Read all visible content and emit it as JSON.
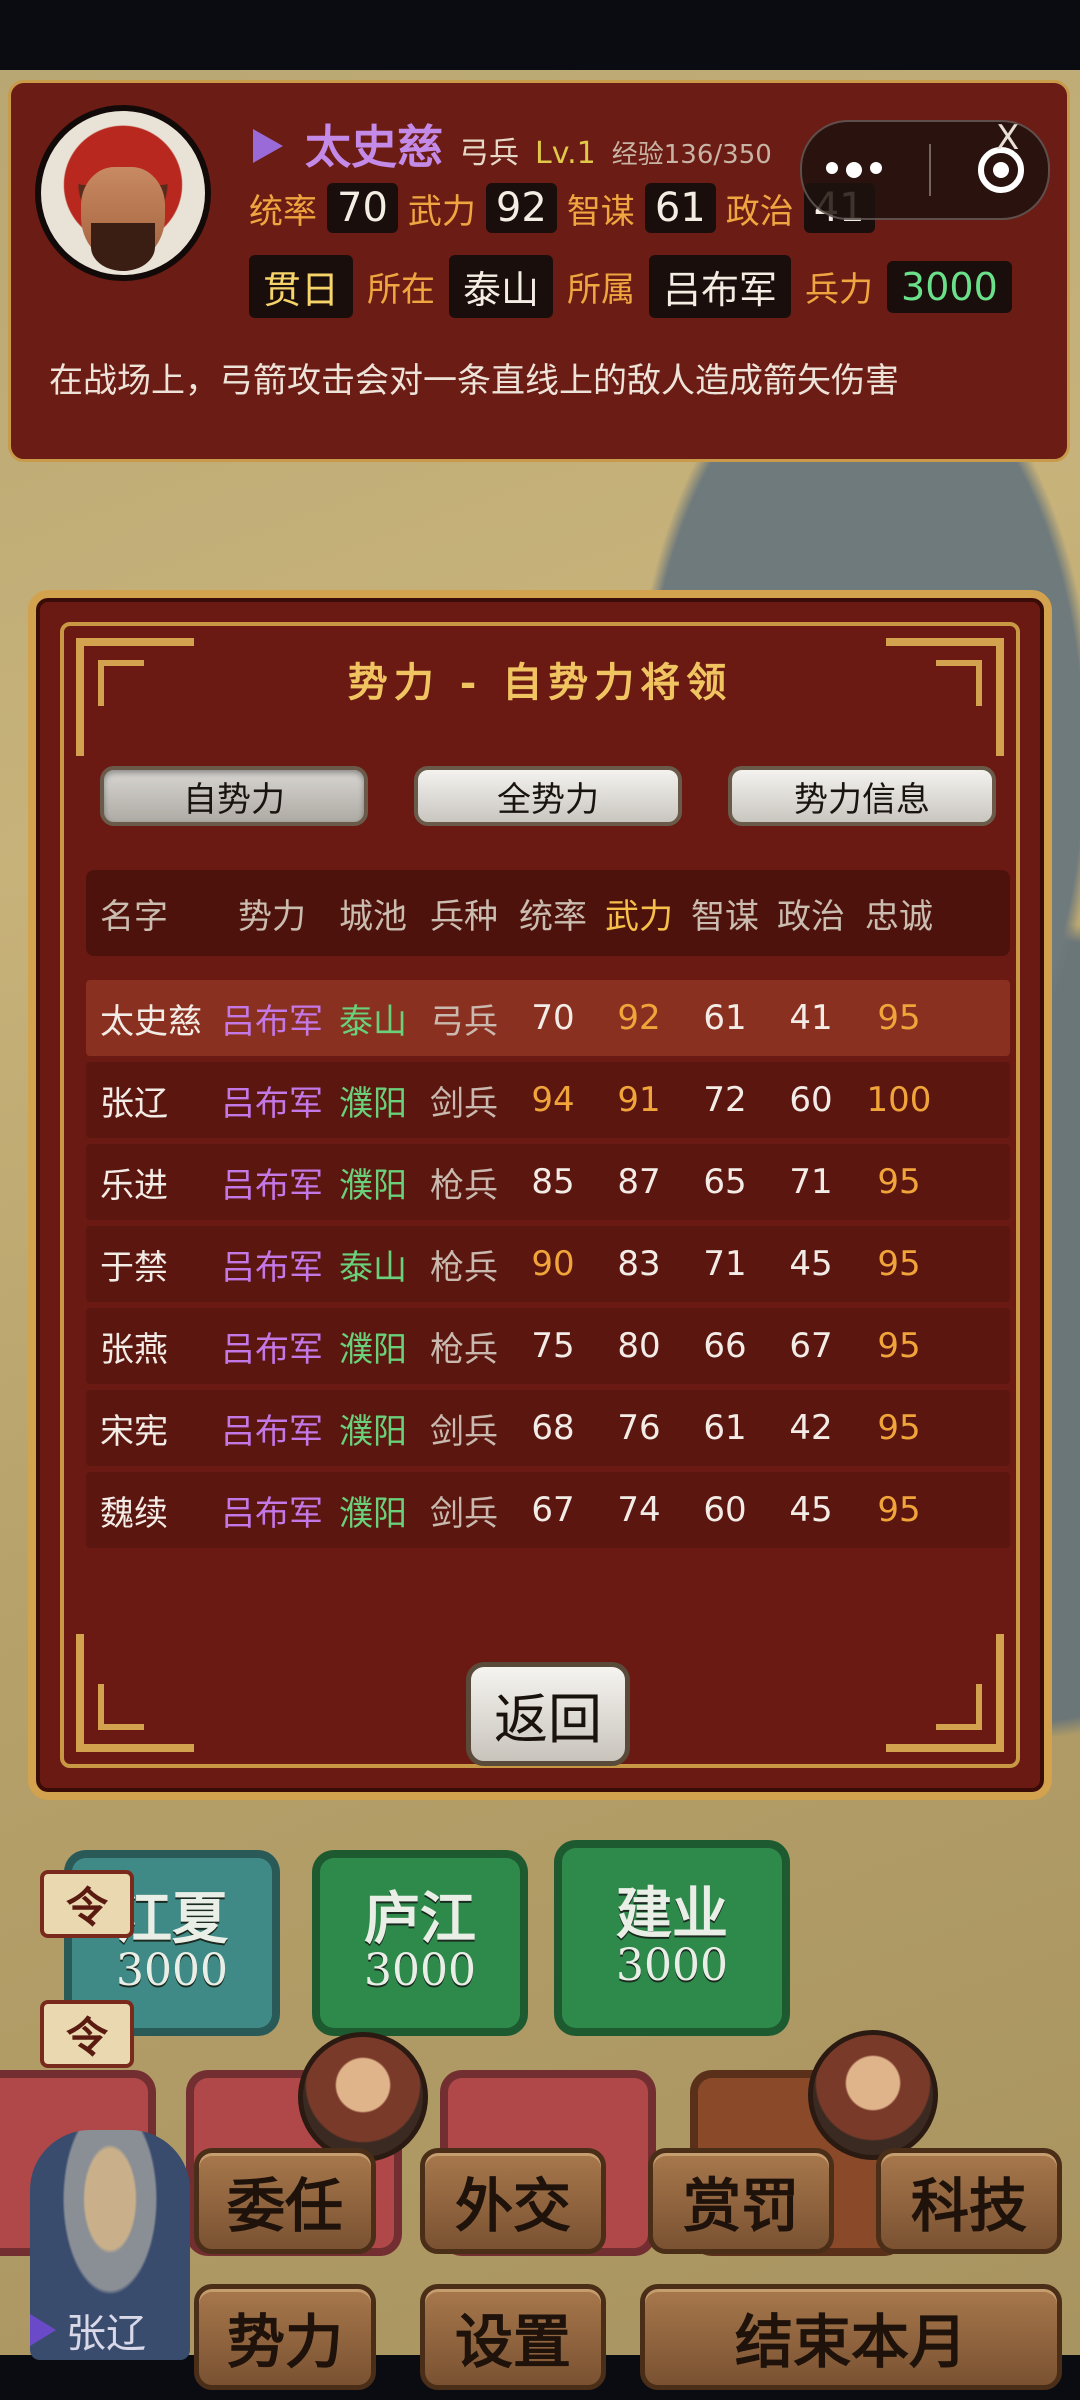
{
  "general_panel": {
    "name": "太史慈",
    "unit_type": "弓兵",
    "level": "Lv.1",
    "exp": "经验136/350",
    "stats": [
      {
        "label": "统率",
        "value": "70"
      },
      {
        "label": "武力",
        "value": "92"
      },
      {
        "label": "智谋",
        "value": "61"
      },
      {
        "label": "政治",
        "value": "41"
      }
    ],
    "trait": "贯日",
    "location_label": "所在",
    "location": "泰山",
    "faction_label": "所属",
    "faction": "吕布军",
    "troops_label": "兵力",
    "troops": "3000",
    "description": "在战场上，弓箭攻击会对一条直线上的敌人造成箭矢伤害",
    "close_glyph": "X"
  },
  "dialog": {
    "title": "势力 - 自势力将领",
    "tabs": [
      "自势力",
      "全势力",
      "势力信息"
    ],
    "columns": [
      "名字",
      "势力",
      "城池",
      "兵种",
      "统率",
      "武力",
      "智谋",
      "政治",
      "忠诚"
    ],
    "rows": [
      {
        "name": "太史慈",
        "force": "吕布军",
        "city": "泰山",
        "type": "弓兵",
        "tong": "70",
        "wu": "92",
        "zhi": "61",
        "zheng": "41",
        "loyal": "95"
      },
      {
        "name": "张辽",
        "force": "吕布军",
        "city": "濮阳",
        "type": "剑兵",
        "tong": "94",
        "wu": "91",
        "zhi": "72",
        "zheng": "60",
        "loyal": "100"
      },
      {
        "name": "乐进",
        "force": "吕布军",
        "city": "濮阳",
        "type": "枪兵",
        "tong": "85",
        "wu": "87",
        "zhi": "65",
        "zheng": "71",
        "loyal": "95"
      },
      {
        "name": "于禁",
        "force": "吕布军",
        "city": "泰山",
        "type": "枪兵",
        "tong": "90",
        "wu": "83",
        "zhi": "71",
        "zheng": "45",
        "loyal": "95"
      },
      {
        "name": "张燕",
        "force": "吕布军",
        "city": "濮阳",
        "type": "枪兵",
        "tong": "75",
        "wu": "80",
        "zhi": "66",
        "zheng": "67",
        "loyal": "95"
      },
      {
        "name": "宋宪",
        "force": "吕布军",
        "city": "濮阳",
        "type": "剑兵",
        "tong": "68",
        "wu": "76",
        "zhi": "61",
        "zheng": "42",
        "loyal": "95"
      },
      {
        "name": "魏续",
        "force": "吕布军",
        "city": "濮阳",
        "type": "剑兵",
        "tong": "67",
        "wu": "74",
        "zhi": "60",
        "zheng": "45",
        "loyal": "95"
      }
    ],
    "back_label": "返回"
  },
  "map": {
    "cities": [
      {
        "name": "江夏",
        "troops": "3000"
      },
      {
        "name": "庐江",
        "troops": "3000"
      },
      {
        "name": "建业",
        "troops": "3000"
      }
    ],
    "order_glyph": "令",
    "selected_general": "张辽"
  },
  "bottom_menu": {
    "row1": [
      "委任",
      "外交",
      "赏罚",
      "科技"
    ],
    "row2": [
      "势力",
      "设置",
      "结束本月"
    ]
  },
  "colors": {
    "panel_bg": "#6b1c14",
    "gold_border": "#d2a24e",
    "name_purple": "#c48ae8",
    "troops_green": "#6ae08a",
    "highlight_orange": "#f1a43a"
  }
}
